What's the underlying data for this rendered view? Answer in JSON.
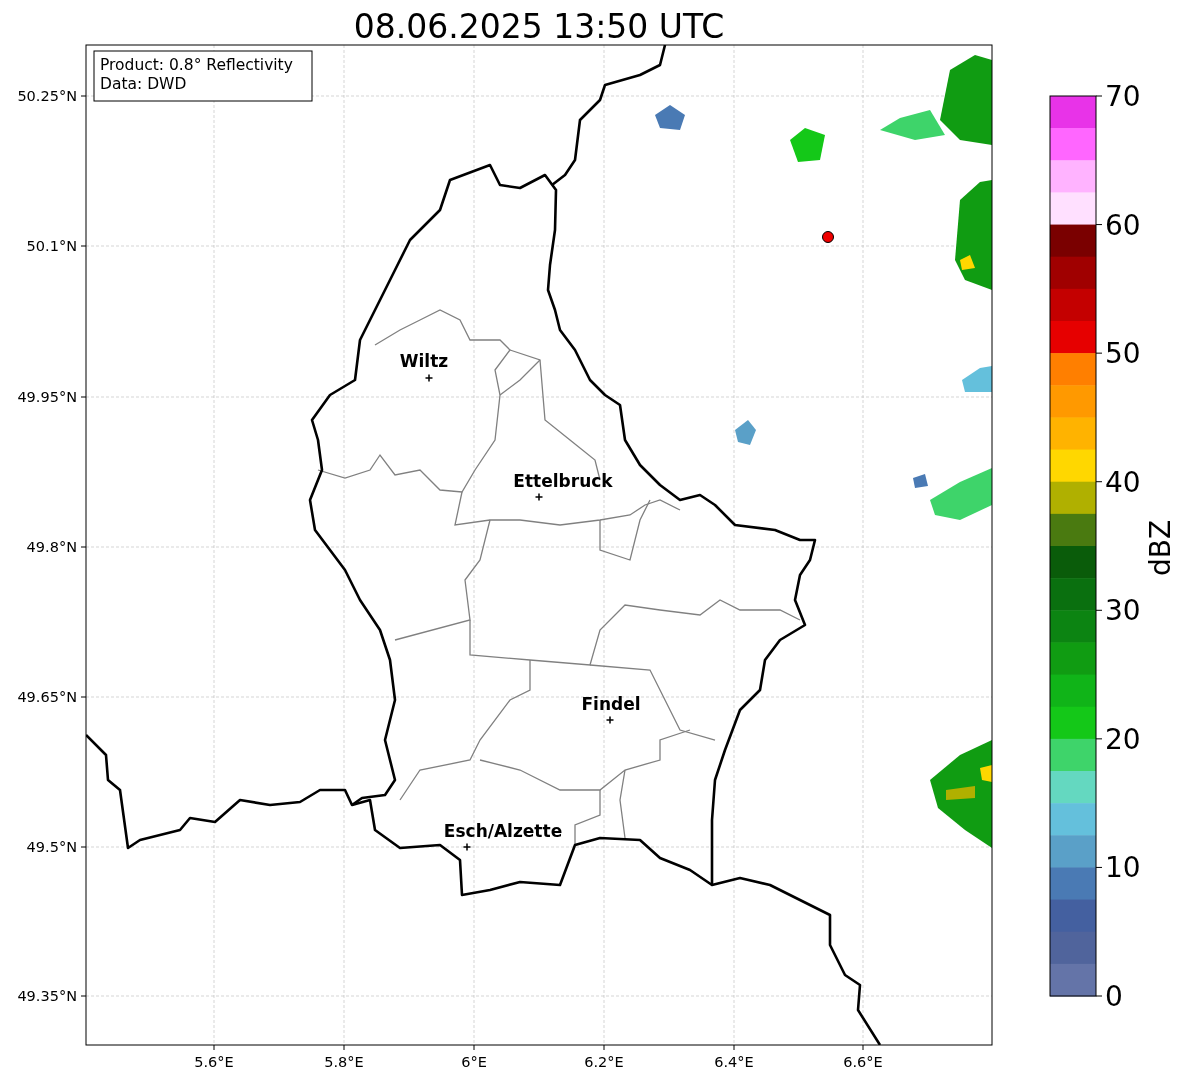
{
  "title": "08.06.2025 13:50 UTC",
  "info_box": {
    "lines": [
      "Product: 0.8° Reflectivity",
      "Data: DWD"
    ]
  },
  "map": {
    "x_ticks": [
      "5.6°E",
      "5.8°E",
      "6°E",
      "6.2°E",
      "6.4°E",
      "6.6°E"
    ],
    "y_ticks": [
      "50.25°N",
      "50.1°N",
      "49.95°N",
      "49.8°N",
      "49.65°N",
      "49.5°N",
      "49.35°N"
    ],
    "cities": [
      {
        "name": "Wiltz"
      },
      {
        "name": "Ettelbruck"
      },
      {
        "name": "Findel"
      },
      {
        "name": "Esch/Alzette"
      }
    ]
  },
  "colorbar": {
    "label": "dBZ",
    "ticks": [
      "70",
      "60",
      "50",
      "40",
      "30",
      "20",
      "10",
      "0"
    ],
    "bins": [
      {
        "color": "#e833e8"
      },
      {
        "color": "#ff66ff"
      },
      {
        "color": "#ffb3ff"
      },
      {
        "color": "#ffe0ff"
      },
      {
        "color": "#7a0000"
      },
      {
        "color": "#a00000"
      },
      {
        "color": "#c40000"
      },
      {
        "color": "#e60000"
      },
      {
        "color": "#ff7f00"
      },
      {
        "color": "#ff9900"
      },
      {
        "color": "#ffb300"
      },
      {
        "color": "#ffd700"
      },
      {
        "color": "#b0b000"
      },
      {
        "color": "#4a7a10"
      },
      {
        "color": "#0a5c0a"
      },
      {
        "color": "#0a700f"
      },
      {
        "color": "#0c8412"
      },
      {
        "color": "#109c12"
      },
      {
        "color": "#10b418"
      },
      {
        "color": "#14c818"
      },
      {
        "color": "#3ed46a"
      },
      {
        "color": "#64d8c0"
      },
      {
        "color": "#64c0dc"
      },
      {
        "color": "#5aa0c8"
      },
      {
        "color": "#4a7ab4"
      },
      {
        "color": "#4460a0"
      },
      {
        "color": "#50649c"
      },
      {
        "color": "#6474a8"
      }
    ]
  }
}
